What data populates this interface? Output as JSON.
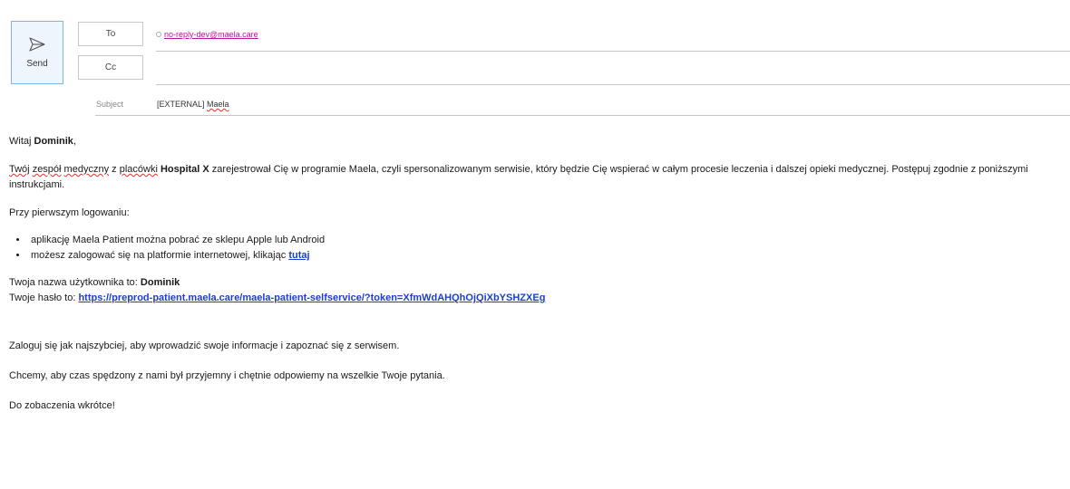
{
  "compose": {
    "send_label": "Send",
    "to_label": "To",
    "cc_label": "Cc",
    "to_recipient": "no-reply-dev@maela.care",
    "cc_value": "",
    "subject_label": "Subject",
    "subject_prefix": "[EXTERNAL] ",
    "subject_main": "Maela"
  },
  "body": {
    "greeting_prefix": "Witaj ",
    "greeting_name": "Dominik",
    "greeting_suffix": ",",
    "intro_w1": "Twój",
    "intro_sp1": " ",
    "intro_w2": "zespół",
    "intro_sp2": " ",
    "intro_w3": "medyczny",
    "intro_sp3": " z ",
    "intro_w4": "placówki",
    "intro_sp4": " ",
    "intro_hospital": "Hospital X",
    "intro_rest": " zarejestrował Cię w programie Maela, czyli spersonalizowanym serwisie, który będzie Cię wspierać w całym procesie leczenia i dalszej opieki medycznej. Postępuj zgodnie z poniższymi instrukcjami.",
    "first_login": "Przy pierwszym logowaniu:",
    "bullet_1": "aplikację Maela Patient można pobrać ze sklepu Apple lub Android",
    "bullet_2_text": "możesz zalogować się na platformie internetowej, klikając ",
    "bullet_2_link": "tutaj",
    "username_label": "Twoja nazwa użytkownika to: ",
    "username_value": "Dominik",
    "password_label": "Twoje hasło to: ",
    "password_link": "https://preprod-patient.maela.care/maela-patient-selfservice/?token=XfmWdAHQhOjQiXbYSHZXEg",
    "login_soon": "Zaloguj się jak najszybciej, aby wprowadzić swoje informacje i zapoznać się z serwisem.",
    "we_want": "Chcemy, aby czas spędzony z nami był przyjemny i chętnie odpowiemy na wszelkie Twoje pytania.",
    "see_you": "Do zobaczenia wkrótce!"
  }
}
